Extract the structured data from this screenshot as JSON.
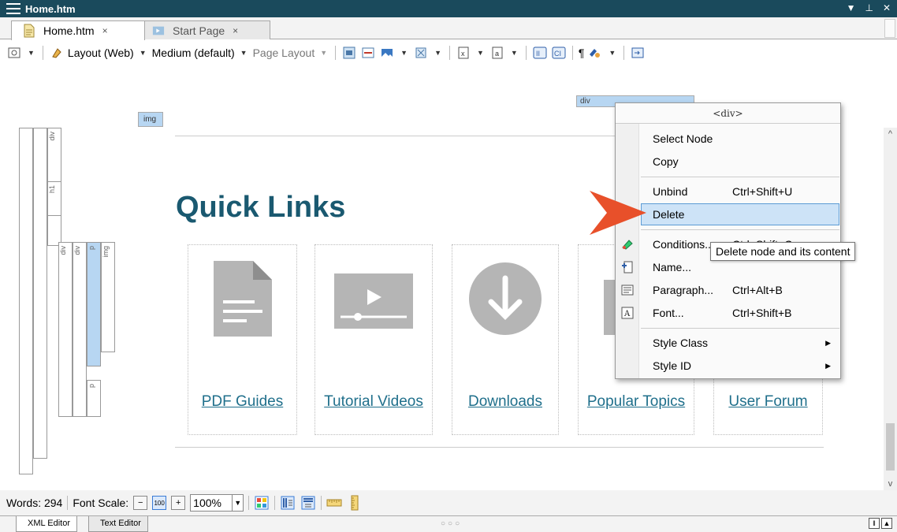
{
  "window": {
    "title": "Home.htm"
  },
  "tabs": [
    {
      "label": "Home.htm",
      "close": "×"
    },
    {
      "label": "Start Page",
      "close": "×"
    }
  ],
  "toolbar": {
    "layout_label": "Layout (Web)",
    "medium_label": "Medium (default)",
    "page_layout_label": "Page Layout",
    "pilcrow": "¶"
  },
  "tags": {
    "div_outer": "div",
    "div_inner": "div",
    "img": "img"
  },
  "structure_labels": [
    "div",
    "h1",
    "div",
    "div",
    "p",
    "img",
    "p"
  ],
  "content": {
    "heading": "Quick Links",
    "cards": [
      {
        "label": "PDF Guides",
        "icon": "document-icon"
      },
      {
        "label": "Tutorial Videos",
        "icon": "video-icon"
      },
      {
        "label": "Downloads",
        "icon": "download-icon"
      },
      {
        "label": "Popular Topics",
        "icon": "star-icon"
      },
      {
        "label": "User Forum",
        "icon": "forum-icon"
      }
    ]
  },
  "context_menu": {
    "header": "<div>",
    "items": [
      {
        "label": "Select Node",
        "shortcut": ""
      },
      {
        "label": "Copy",
        "shortcut": ""
      },
      {
        "label": "Unbind",
        "shortcut": "Ctrl+Shift+U"
      },
      {
        "label": "Delete",
        "shortcut": ""
      },
      {
        "label": "Conditions...",
        "shortcut": "Ctrl+Shift+C"
      },
      {
        "label": "Name...",
        "shortcut": ""
      },
      {
        "label": "Paragraph...",
        "shortcut": "Ctrl+Alt+B"
      },
      {
        "label": "Font...",
        "shortcut": "Ctrl+Shift+B"
      },
      {
        "label": "Style Class",
        "shortcut": ""
      },
      {
        "label": "Style ID",
        "shortcut": ""
      }
    ]
  },
  "tooltip": "Delete node and its content",
  "status": {
    "words": "Words: 294",
    "font_scale": "Font Scale:",
    "zoom": "100%",
    "zoom_icon_text": "100"
  },
  "bottom_tabs": [
    "XML Editor",
    "Text Editor"
  ],
  "colors": {
    "titlebar": "#1a4a5c",
    "heading": "#1a5970",
    "link": "#1f6f8b",
    "pointer": "#e8502a",
    "highlight": "#cde3f7"
  }
}
